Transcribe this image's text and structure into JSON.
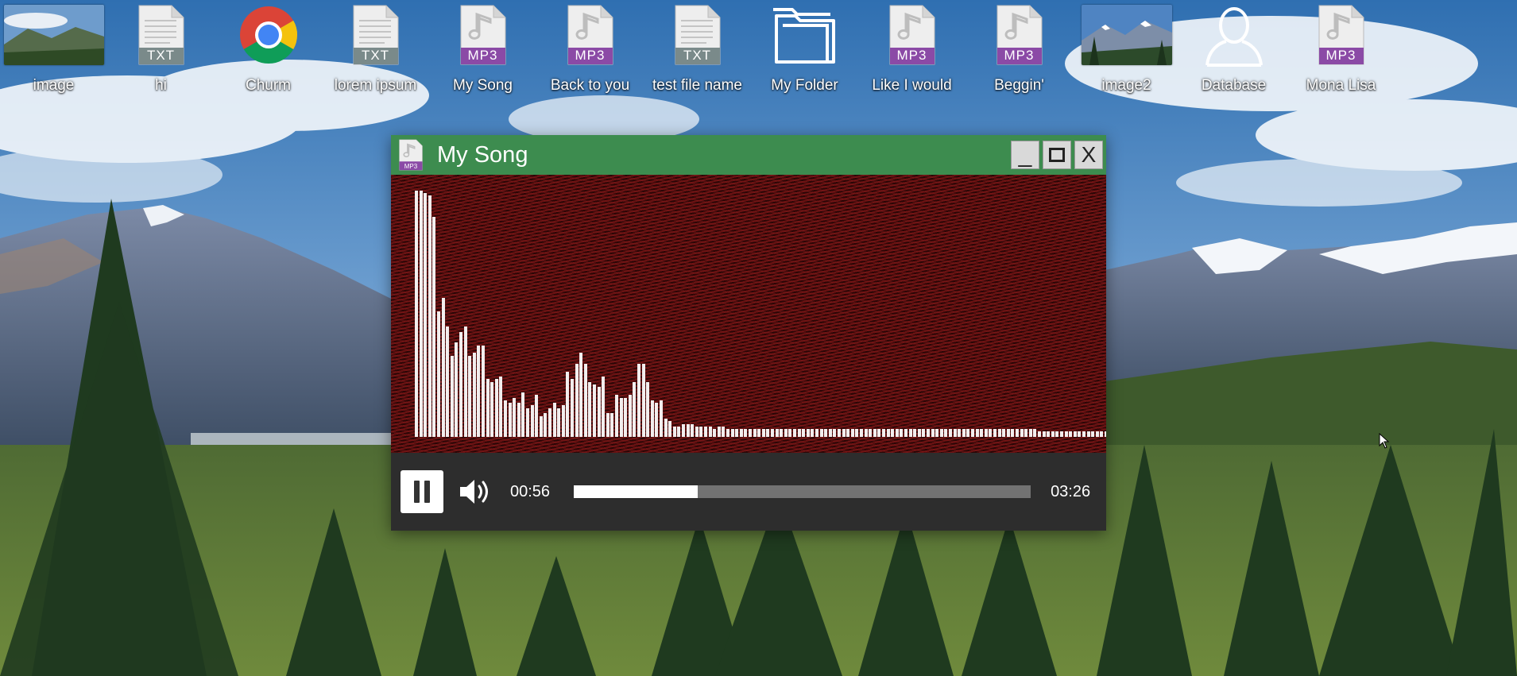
{
  "desktop": {
    "icons": [
      {
        "label": "image",
        "type": "image"
      },
      {
        "label": "hi",
        "type": "txt",
        "ext": "TXT"
      },
      {
        "label": "Churm",
        "type": "browser"
      },
      {
        "label": "lorem ipsum",
        "type": "txt",
        "ext": "TXT"
      },
      {
        "label": "My Song",
        "type": "mp3",
        "ext": "MP3"
      },
      {
        "label": "Back to you",
        "type": "mp3",
        "ext": "MP3"
      },
      {
        "label": "test file name",
        "type": "txt",
        "ext": "TXT"
      },
      {
        "label": "My Folder",
        "type": "folder"
      },
      {
        "label": "Like I would",
        "type": "mp3",
        "ext": "MP3"
      },
      {
        "label": "Beggin'",
        "type": "mp3",
        "ext": "MP3"
      },
      {
        "label": "image2",
        "type": "image"
      },
      {
        "label": "Database",
        "type": "user"
      },
      {
        "label": "Mona Lisa",
        "type": "mp3",
        "ext": "MP3"
      }
    ]
  },
  "player": {
    "title": "My Song",
    "icon": "mp3-file-icon",
    "icon_ext": "MP3",
    "controls": {
      "minimize": "_",
      "maximize": "□",
      "close": "X"
    },
    "current_time": "00:56",
    "duration": "03:26",
    "progress": 0.272,
    "visualizer_levels": [
      0.94,
      0.94,
      0.93,
      0.92,
      0.84,
      0.48,
      0.53,
      0.42,
      0.31,
      0.36,
      0.4,
      0.42,
      0.31,
      0.32,
      0.35,
      0.35,
      0.22,
      0.21,
      0.22,
      0.23,
      0.14,
      0.13,
      0.15,
      0.13,
      0.17,
      0.11,
      0.12,
      0.16,
      0.08,
      0.09,
      0.11,
      0.13,
      0.11,
      0.12,
      0.25,
      0.22,
      0.28,
      0.32,
      0.28,
      0.21,
      0.2,
      0.19,
      0.23,
      0.09,
      0.09,
      0.16,
      0.15,
      0.15,
      0.16,
      0.21,
      0.28,
      0.28,
      0.21,
      0.14,
      0.13,
      0.14,
      0.07,
      0.06,
      0.04,
      0.04,
      0.05,
      0.05,
      0.05,
      0.04,
      0.04,
      0.04,
      0.04,
      0.03,
      0.04,
      0.04,
      0.03,
      0.03,
      0.03,
      0.03,
      0.03,
      0.03,
      0.03,
      0.03,
      0.03,
      0.03,
      0.03,
      0.03,
      0.03,
      0.03,
      0.03,
      0.03,
      0.03,
      0.03,
      0.03,
      0.03,
      0.03,
      0.03,
      0.03,
      0.03,
      0.03,
      0.03,
      0.03,
      0.03,
      0.03,
      0.03,
      0.03,
      0.03,
      0.03,
      0.03,
      0.03,
      0.03,
      0.03,
      0.03,
      0.03,
      0.03,
      0.03,
      0.03,
      0.03,
      0.03,
      0.03,
      0.03,
      0.03,
      0.03,
      0.03,
      0.03,
      0.03,
      0.03,
      0.03,
      0.03,
      0.03,
      0.03,
      0.03,
      0.03,
      0.03,
      0.03,
      0.03,
      0.03,
      0.03,
      0.03,
      0.03,
      0.03,
      0.03,
      0.03,
      0.03,
      0.03,
      0.02,
      0.02,
      0.02,
      0.02,
      0.02,
      0.02,
      0.02,
      0.02,
      0.02,
      0.02,
      0.02,
      0.02,
      0.02,
      0.02,
      0.02,
      0.02,
      0.02
    ]
  },
  "colors": {
    "titlebar": "#3d8c4f",
    "mp3_badge": "#8b4aa6",
    "txt_badge": "#7a8a8a",
    "controls_bg": "#2d2d2d",
    "visualizer_red": "#6a1212"
  }
}
